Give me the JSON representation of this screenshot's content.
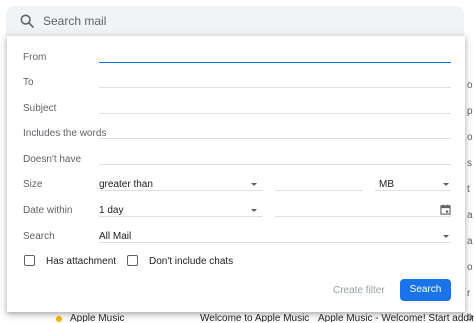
{
  "search": {
    "placeholder": "Search mail"
  },
  "form": {
    "from_label": "From",
    "to_label": "To",
    "subject_label": "Subject",
    "includes_label": "Includes the words",
    "doesnt_have_label": "Doesn't have",
    "size_label": "Size",
    "size_operator": "greater than",
    "size_unit": "MB",
    "date_label": "Date within",
    "date_value": "1 day",
    "search_label": "Search",
    "search_scope": "All Mail",
    "has_attachment_label": "Has attachment",
    "no_chats_label": "Don't include chats"
  },
  "actions": {
    "create_filter": "Create filter",
    "search": "Search"
  },
  "background": {
    "right_glyphs": [
      "o",
      "p",
      "o",
      "s",
      "t",
      "a",
      "a",
      "o",
      "r",
      "o"
    ],
    "bottom_sender": "Apple Music",
    "bottom_subject": "Welcome to Apple Music",
    "bottom_snippet": "Apple Music - Welcome! Start adding"
  },
  "colors": {
    "accent": "#1a73e8",
    "search_bg": "#f1f3f4",
    "muted_text": "#5f6368",
    "disabled_text": "#9aa0a6"
  }
}
